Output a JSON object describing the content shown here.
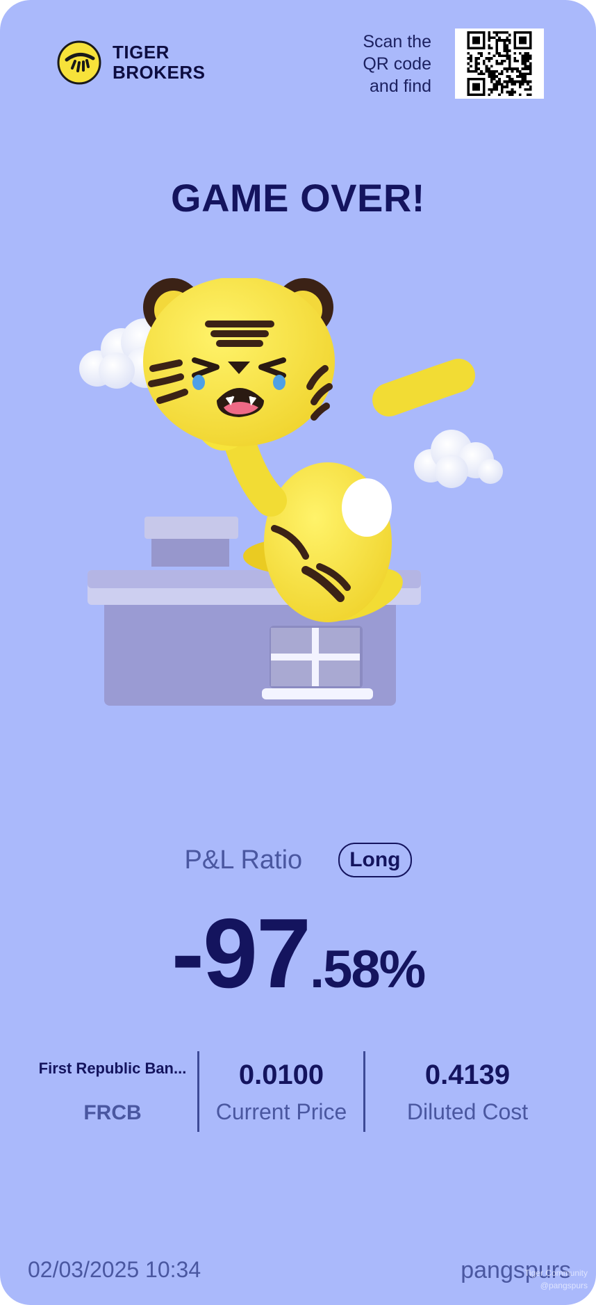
{
  "brand": {
    "line1": "TIGER",
    "line2": "BROKERS",
    "logo_icon": "tiger-logo-icon"
  },
  "qr": {
    "line1": "Scan the",
    "line2": "QR code",
    "line3": "and find"
  },
  "title": "GAME OVER!",
  "pl": {
    "label": "P&L Ratio",
    "position": "Long",
    "ratio_int": "-97",
    "ratio_dec": ".58%"
  },
  "stock": {
    "name": "First Republic Ban...",
    "symbol": "FRCB",
    "current_price": "0.0100",
    "current_price_label": "Current Price",
    "diluted_cost": "0.4139",
    "diluted_cost_label": "Diluted Cost"
  },
  "footer": {
    "datetime": "02/03/2025 10:34",
    "username": "pangspurs",
    "watermark_line1": "Tiger Community",
    "watermark_line2": "@pangspurs"
  },
  "colors": {
    "background": "#aab9fb",
    "primary_text": "#14145e",
    "secondary_text": "#4a57a0",
    "tiger_yellow": "#f7e43a"
  }
}
